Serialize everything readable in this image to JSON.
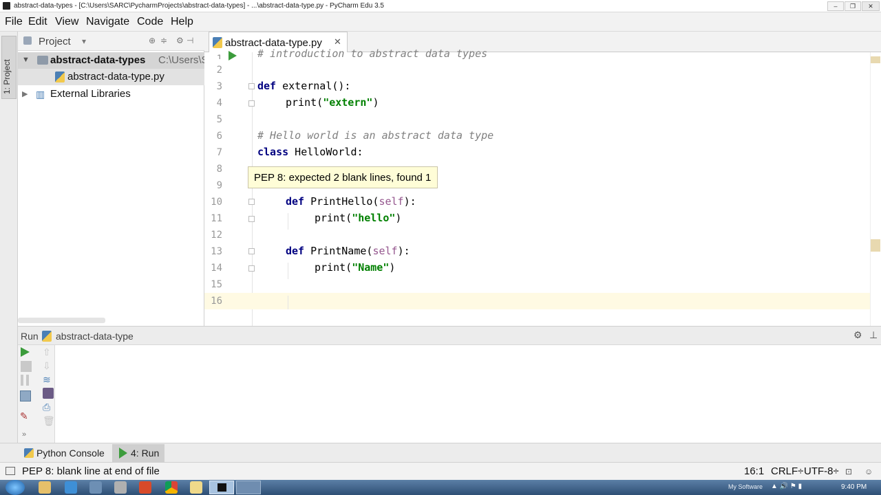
{
  "window": {
    "title": "abstract-data-types - [C:\\Users\\SARC\\PycharmProjects\\abstract-data-types] - ...\\abstract-data-type.py - PyCharm Edu 3.5"
  },
  "menu": [
    "File",
    "Edit",
    "View",
    "Navigate",
    "Code",
    "Help"
  ],
  "left_strip": {
    "project_tab": "1: Project"
  },
  "project": {
    "header": "Project",
    "tree": [
      {
        "label": "abstract-data-types",
        "path": "C:\\Users\\S"
      },
      {
        "label": "abstract-data-type.py"
      },
      {
        "label": "External Libraries"
      }
    ]
  },
  "editor": {
    "tab": "abstract-data-type.py",
    "lines": {
      "1": "# introduction to abstract data types",
      "3_kw": "def",
      "3_rest": " external():",
      "4_fn": "print(",
      "4_str": "\"extern\"",
      "4_end": ")",
      "6": "# Hello world is an abstract data type",
      "7_kw": "class",
      "7_rest": " HelloWorld:",
      "10_kw": "def",
      "10_name": " PrintHello(",
      "10_self": "self",
      "10_end": "):",
      "11_fn": "print(",
      "11_str": "\"hello\"",
      "11_end": ")",
      "13_kw": "def",
      "13_name": " PrintName(",
      "13_self": "self",
      "13_end": "):",
      "14_fn": "print(",
      "14_str": "\"Name\"",
      "14_end": ")"
    },
    "line_numbers": [
      "1",
      "2",
      "3",
      "4",
      "5",
      "6",
      "7",
      "8",
      "9",
      "10",
      "11",
      "12",
      "13",
      "14",
      "15",
      "16"
    ],
    "tooltip": "PEP 8: expected 2 blank lines, found 1"
  },
  "run": {
    "label": "Run",
    "config": "abstract-data-type"
  },
  "bottom_tabs": {
    "console": "Python Console",
    "run": "4: Run"
  },
  "status": {
    "message": "PEP 8: blank line at end of file",
    "position": "16:1",
    "line_sep": "CRLF÷",
    "encoding": "UTF-8÷"
  },
  "taskbar": {
    "tray_label": "My Software",
    "time": "9:40 PM"
  }
}
